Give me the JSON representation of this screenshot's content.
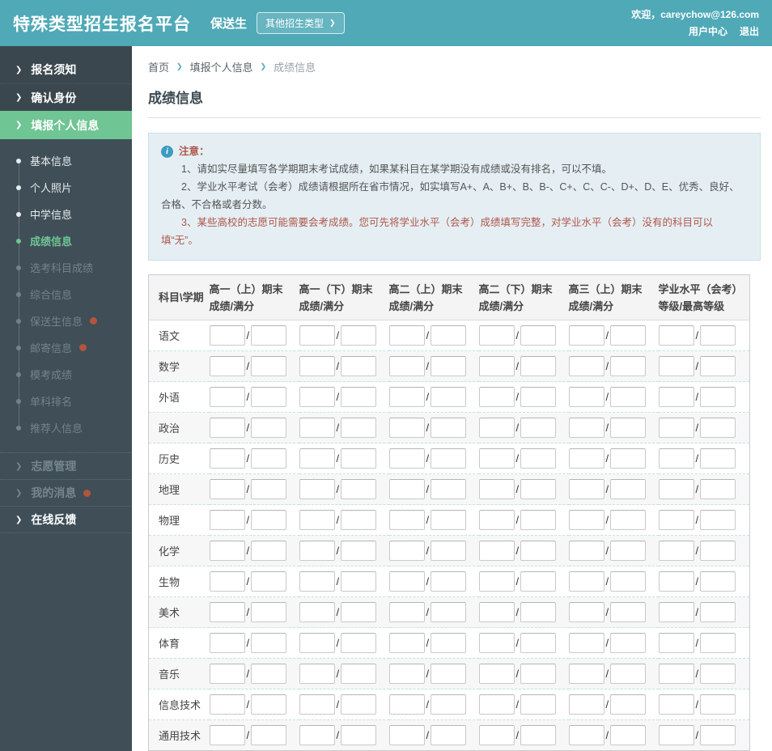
{
  "icons": {
    "chevron_right": "❯",
    "bullet": "●",
    "info": "i",
    "slash": "/"
  },
  "colors": {
    "header_teal": "#4FA9B7",
    "sidebar_dark": "#3F4E57",
    "sidebar_darker": "#3B474E",
    "active_green": "#6FC593",
    "notice_bg": "#E5EFF3",
    "notice_accent": "#B0564A",
    "notification_dot": "#B2553E"
  },
  "header": {
    "title": "特殊类型招生报名平台",
    "badge": "保送生",
    "other_types_button": "其他招生类型",
    "welcome": "欢迎，careychow@126.com",
    "user_center": "用户中心",
    "logout": "退出"
  },
  "sidebar": {
    "top_items": [
      {
        "name": "application-notice",
        "label": "报名须知"
      },
      {
        "name": "confirm-identity",
        "label": "确认身份"
      }
    ],
    "active_parent": {
      "name": "personal-info",
      "label": "填报个人信息"
    },
    "sub_items": [
      {
        "name": "basic-info",
        "label": "基本信息",
        "state": "normal",
        "dot": false
      },
      {
        "name": "personal-photo",
        "label": "个人照片",
        "state": "normal",
        "dot": false
      },
      {
        "name": "school-info",
        "label": "中学信息",
        "state": "normal",
        "dot": false
      },
      {
        "name": "score-info",
        "label": "成绩信息",
        "state": "active",
        "dot": false
      },
      {
        "name": "elective-subject-scores",
        "label": "选考科目成绩",
        "state": "disabled",
        "dot": false
      },
      {
        "name": "comprehensive-info",
        "label": "综合信息",
        "state": "disabled",
        "dot": false
      },
      {
        "name": "recommended-student-info",
        "label": "保送生信息",
        "state": "disabled",
        "dot": true
      },
      {
        "name": "mailing-info",
        "label": "邮寄信息",
        "state": "disabled",
        "dot": true
      },
      {
        "name": "mock-exam-scores",
        "label": "模考成绩",
        "state": "disabled",
        "dot": false
      },
      {
        "name": "subject-ranking",
        "label": "单科排名",
        "state": "disabled",
        "dot": false
      },
      {
        "name": "referrer-info",
        "label": "推荐人信息",
        "state": "disabled",
        "dot": false
      }
    ],
    "bottom_items": [
      {
        "name": "application-management",
        "label": "志愿管理",
        "state": "dim",
        "dot": false
      },
      {
        "name": "my-messages",
        "label": "我的消息",
        "state": "dim",
        "dot": true
      },
      {
        "name": "online-feedback",
        "label": "在线反馈",
        "state": "normal",
        "dot": false
      }
    ]
  },
  "breadcrumb": {
    "items": [
      {
        "name": "home",
        "label": "首页",
        "link": true
      },
      {
        "name": "personal-info",
        "label": "填报个人信息",
        "link": true
      },
      {
        "name": "score-info",
        "label": "成绩信息",
        "link": false
      }
    ]
  },
  "page": {
    "title": "成绩信息"
  },
  "notice": {
    "title": "注意：",
    "lines": [
      {
        "text": "1、请如实尽量填写各学期期末考试成绩，如果某科目在某学期没有成绩或没有排名，可以不填。",
        "accent": false
      },
      {
        "text": "2、学业水平考试（会考）成绩请根据所在省市情况，如实填写A+、A、B+、B、B-、C+、C、C-、D+、D、E、优秀、良好、合格、不合格或者分数。",
        "accent": false
      },
      {
        "text": "3、某些高校的志愿可能需要会考成绩。您可先将学业水平（会考）成绩填写完整，对学业水平（会考）没有的科目可以填“无”。",
        "accent": true
      }
    ]
  },
  "table": {
    "corner_header": "科目\\学期",
    "columns": [
      {
        "line1": "高一（上）期末",
        "line2": "成绩/满分"
      },
      {
        "line1": "高一（下）期末",
        "line2": "成绩/满分"
      },
      {
        "line1": "高二（上）期末",
        "line2": "成绩/满分"
      },
      {
        "line1": "高二（下）期末",
        "line2": "成绩/满分"
      },
      {
        "line1": "高三（上）期末",
        "line2": "成绩/满分"
      },
      {
        "line1": "学业水平（会考）",
        "line2": "等级/最高等级"
      }
    ],
    "subjects": [
      "语文",
      "数学",
      "外语",
      "政治",
      "历史",
      "地理",
      "物理",
      "化学",
      "生物",
      "美术",
      "体育",
      "音乐",
      "信息技术",
      "通用技术"
    ],
    "input_value": ""
  }
}
